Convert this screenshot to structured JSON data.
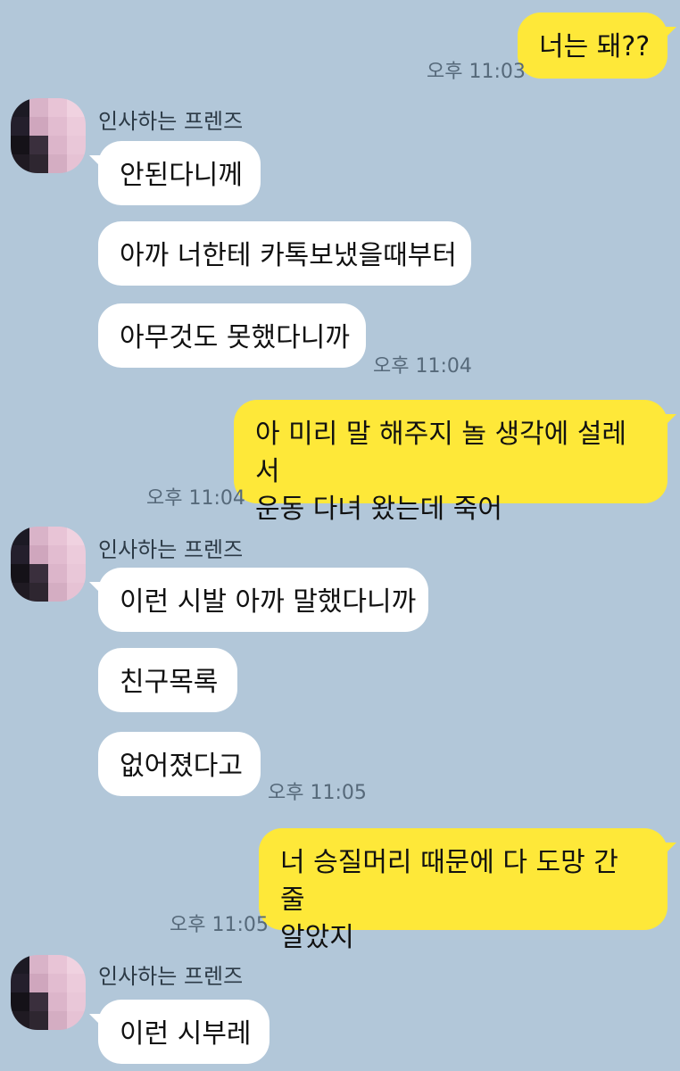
{
  "messages": {
    "m1": {
      "text": "너는 돼??",
      "time": "오후 11:03"
    },
    "g1": {
      "sender": "인사하는 프렌즈",
      "texts": [
        "안된다니께",
        "아까 너한테 카톡보냈을때부터",
        "아무것도 못했다니까"
      ],
      "time": "오후 11:04"
    },
    "m2": {
      "line1": "아 미리 말 해주지 놀 생각에 설레서",
      "line2": "운동 다녀 왔는데 죽어",
      "time": "오후 11:04"
    },
    "g2": {
      "sender": "인사하는 프렌즈",
      "texts": [
        "이런 시발 아까 말했다니까",
        "친구목록",
        "없어졌다고"
      ],
      "time": "오후 11:05"
    },
    "m3": {
      "line1": "너 승질머리 때문에 다 도망 간 줄",
      "line2": "알았지",
      "time": "오후 11:05"
    },
    "g3": {
      "sender": "인사하는 프렌즈",
      "texts": [
        "이런 시부레"
      ]
    }
  },
  "avatar_colors": [
    "#1c1a24",
    "#d9b3c8",
    "#e8c4d6",
    "#f0d2e0",
    "#241f2c",
    "#cfa6bd",
    "#e2bcd0",
    "#eccbdb",
    "#151218",
    "#3a2f3d",
    "#dcb5ca",
    "#e9c7d8",
    "#1f1a22",
    "#2e2630",
    "#d4adc2",
    "#e6c2d4"
  ]
}
